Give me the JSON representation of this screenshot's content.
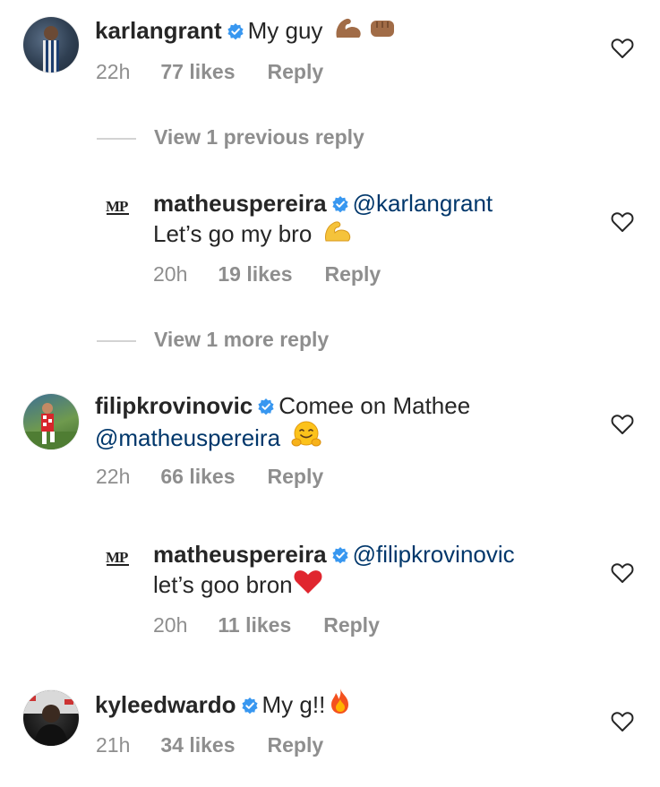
{
  "comments": [
    {
      "username": "karlangrant",
      "text": "My guy",
      "emoji": [
        "flexed-biceps-medium-dark-icon",
        "oncoming-fist-icon"
      ],
      "time": "22h",
      "likes": "77 likes",
      "reply": "Reply"
    },
    {
      "username": "matheuspereira",
      "mention": "@karlangrant",
      "text": "Let’s go my bro",
      "emoji": [
        "flexed-biceps-icon"
      ],
      "time": "20h",
      "likes": "19 likes",
      "reply": "Reply"
    },
    {
      "username": "filipkrovinovic",
      "text": "Comee on Mathee",
      "mention": "@matheuspereira",
      "emoji": [
        "hugging-face-icon"
      ],
      "time": "22h",
      "likes": "66 likes",
      "reply": "Reply"
    },
    {
      "username": "matheuspereira",
      "mention": "@filipkrovinovic",
      "text": "let’s goo bron",
      "emoji": [
        "red-heart-icon"
      ],
      "time": "20h",
      "likes": "11 likes",
      "reply": "Reply"
    },
    {
      "username": "kyleedwardo",
      "text": "My g!!",
      "emoji": [
        "fire-icon"
      ],
      "time": "21h",
      "likes": "34 likes",
      "reply": "Reply"
    }
  ],
  "view_previous": "View 1 previous reply",
  "view_more": "View 1 more reply",
  "logo_text": "MP",
  "colors": {
    "text": "#262626",
    "meta": "#8e8e8e",
    "mention": "#00376b",
    "verified": "#3897f0",
    "divider": "#d3d3d3"
  }
}
